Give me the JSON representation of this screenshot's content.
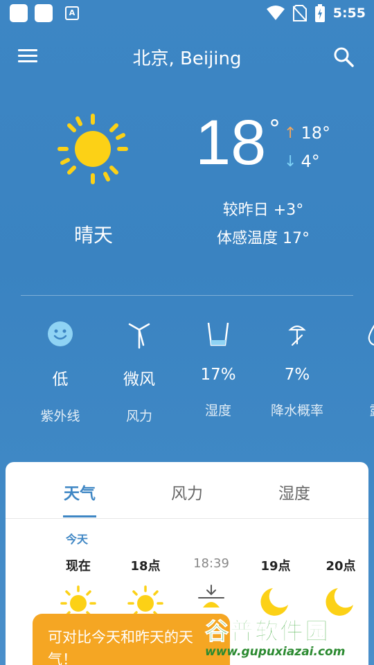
{
  "status_bar": {
    "time": "5:55",
    "app_badge": "A"
  },
  "header": {
    "city": "北京, Beijing"
  },
  "current": {
    "temp": "18",
    "degree": "°",
    "high": "18°",
    "low": "4°",
    "condition": "晴天",
    "compare": "较昨日 +3°",
    "feels_like": "体感温度 17°"
  },
  "metrics": [
    {
      "value": "低",
      "label": "紫外线",
      "icon": "smiley-icon"
    },
    {
      "value": "微风",
      "label": "风力",
      "icon": "wind-turbine-icon"
    },
    {
      "value": "17%",
      "label": "湿度",
      "icon": "water-glass-icon"
    },
    {
      "value": "7%",
      "label": "降水概率",
      "icon": "umbrella-icon"
    },
    {
      "value": "-",
      "label": "露",
      "icon": "droplet-icon"
    }
  ],
  "card": {
    "tabs": [
      "天气",
      "风力",
      "湿度"
    ],
    "today_label": "今天",
    "hours": [
      {
        "label": "现在",
        "icon": "sun-icon"
      },
      {
        "label": "18点",
        "icon": "sun-icon"
      },
      {
        "label": "18:39",
        "icon": "sunset-icon"
      },
      {
        "label": "19点",
        "icon": "moon-icon"
      },
      {
        "label": "20点",
        "icon": "moon-icon"
      }
    ]
  },
  "toast": {
    "text": "可对比今天和昨天的天气！"
  },
  "watermark": {
    "top": "谷普软件园",
    "bottom": "www.gupuxiazai.com"
  },
  "colors": {
    "accent": "#3e86c4",
    "sun": "#fcd116",
    "toast": "#f5a623",
    "high_arrow": "#f0a65e",
    "low_arrow": "#7ed2f6"
  }
}
